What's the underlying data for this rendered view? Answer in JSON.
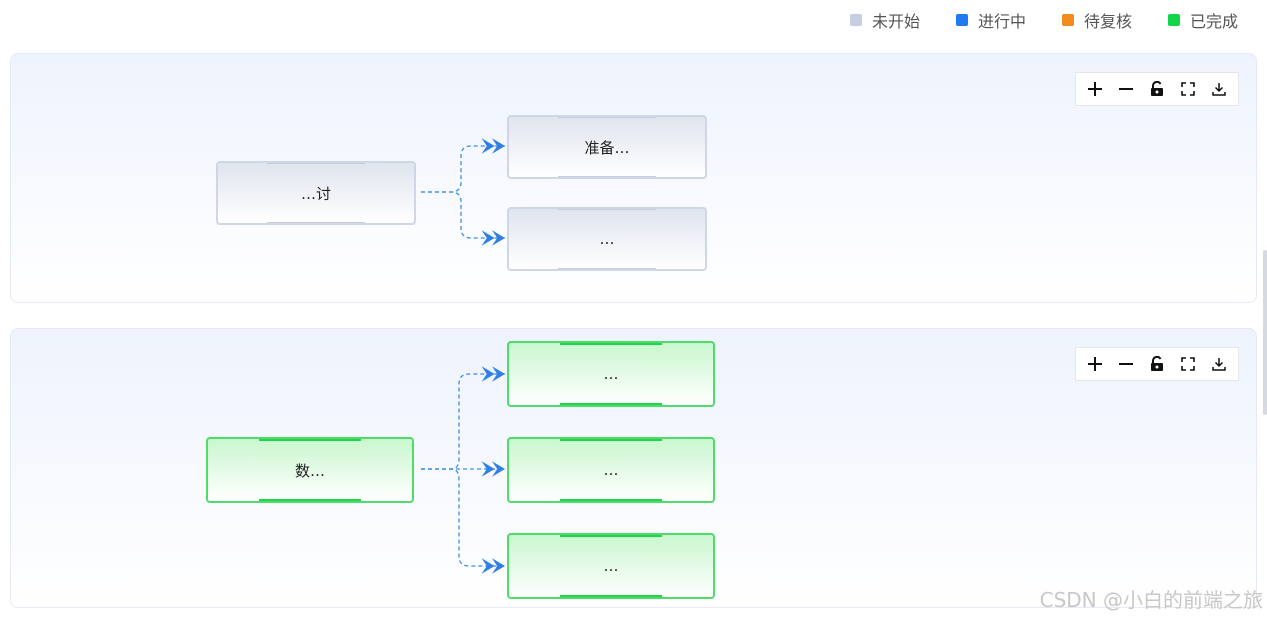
{
  "legend": [
    {
      "label": "未开始",
      "color": "#c5cde0"
    },
    {
      "label": "进行中",
      "color": "#1e7bf0"
    },
    {
      "label": "待复核",
      "color": "#f28c1c"
    },
    {
      "label": "已完成",
      "color": "#12d64a"
    }
  ],
  "toolbar": {
    "icons": [
      "plus-icon",
      "minus-icon",
      "unlock-icon",
      "fullscreen-icon",
      "download-icon"
    ]
  },
  "panels": [
    {
      "status": "未开始",
      "root": {
        "label": "…讨"
      },
      "children": [
        {
          "label": "准备…"
        },
        {
          "label": "…"
        }
      ]
    },
    {
      "status": "已完成",
      "root": {
        "label": "数…"
      },
      "children": [
        {
          "label": "…"
        },
        {
          "label": "…"
        },
        {
          "label": "…"
        }
      ]
    }
  ],
  "colors": {
    "edge": "#3b8ee8",
    "pending_border": "#cfd7e6",
    "done_border": "#4fdc6a"
  },
  "watermark": "CSDN @小白的前端之旅"
}
